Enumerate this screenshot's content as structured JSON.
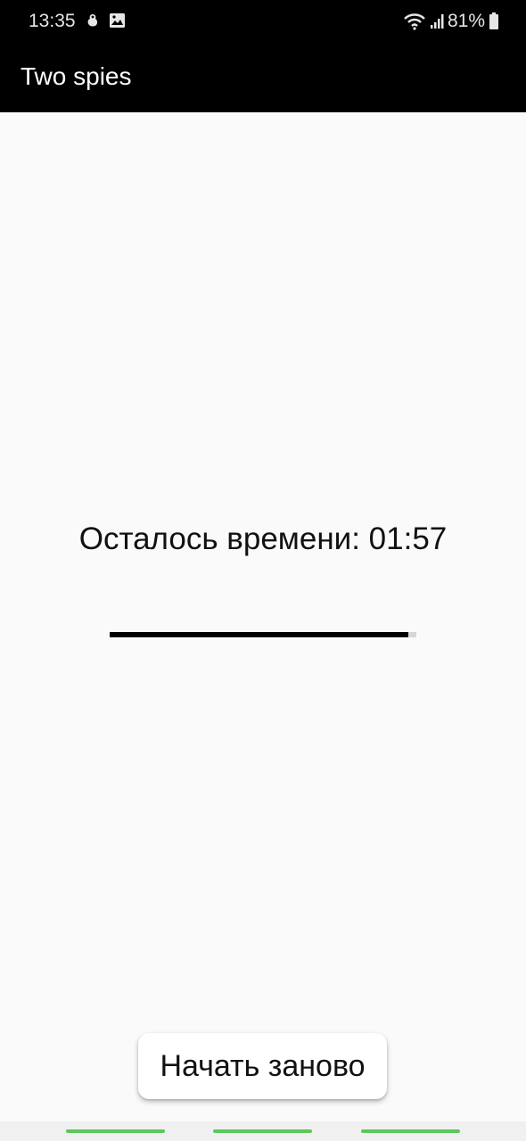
{
  "status_bar": {
    "time": "13:35",
    "battery": "81%",
    "left_icons": [
      "tamagotchi-icon",
      "image-icon"
    ],
    "right_icons": [
      "wifi-icon",
      "signal-icon",
      "battery-icon"
    ]
  },
  "app_bar": {
    "title": "Two spies"
  },
  "main": {
    "timer_text": "Осталось времени: 01:57",
    "progress_fraction": 0.975
  },
  "restart_button": {
    "label": "Начать заново"
  },
  "nav_bar": {
    "pill_color": "#5ac85a",
    "pills": [
      "nav-pill-left",
      "nav-pill-center",
      "nav-pill-right"
    ]
  },
  "colors": {
    "app_bar": "#000000",
    "background": "#fafafa",
    "progress_fill": "#000000",
    "progress_track": "#d6d6d6"
  }
}
